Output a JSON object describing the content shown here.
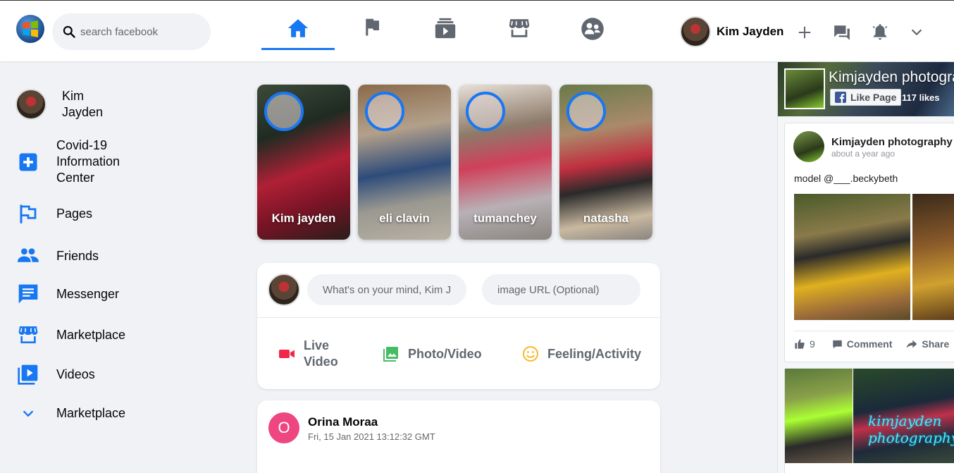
{
  "header": {
    "search_placeholder": "search facebook",
    "profile_name": "Kim Jayden",
    "nav_icons": [
      "home-icon",
      "flag-icon",
      "watch-icon",
      "marketplace-icon",
      "groups-icon"
    ],
    "active_tab": "home"
  },
  "sidebar": {
    "profile_name": "Kim Jayden",
    "items": [
      {
        "label": "Covid-19 Information Center",
        "icon": "plus-square-icon"
      },
      {
        "label": "Pages",
        "icon": "flag-icon"
      },
      {
        "label": "Friends",
        "icon": "people-icon"
      },
      {
        "label": "Messenger",
        "icon": "chat-icon"
      },
      {
        "label": "Marketplace",
        "icon": "store-icon"
      },
      {
        "label": "Videos",
        "icon": "video-library-icon"
      },
      {
        "label": "Marketplace",
        "icon": "chevron-down-icon"
      }
    ]
  },
  "stories": [
    {
      "name": "Kim jayden"
    },
    {
      "name": "eli clavin"
    },
    {
      "name": "tumanchey"
    },
    {
      "name": "natasha"
    }
  ],
  "composer": {
    "text_placeholder": "What's on your mind, Kim Jayden?",
    "image_placeholder": "image URL (Optional)",
    "actions": {
      "live_video": "Live Video",
      "photo_video": "Photo/Video",
      "feeling_activity": "Feeling/Activity"
    }
  },
  "post": {
    "avatar_letter": "O",
    "author": "Orina Moraa",
    "timestamp": "Fri, 15 Jan 2021 13:12:32 GMT"
  },
  "page_widget": {
    "page_name": "Kimjayden photography",
    "like_button": "Like Page",
    "likes": "117 likes",
    "post_author": "Kimjayden photography",
    "post_time": "about a year ago",
    "post_text": "model @___.beckybeth",
    "like_count": "9",
    "comment_label": "Comment",
    "share_label": "Share",
    "watermark": "kimjayden photography"
  },
  "colors": {
    "accent": "#1877f2",
    "background": "#f0f2f5",
    "live_red": "#f02849",
    "photo_green": "#45bd62",
    "feeling_yellow": "#f7b928",
    "avatar_pink": "#ed4680"
  }
}
